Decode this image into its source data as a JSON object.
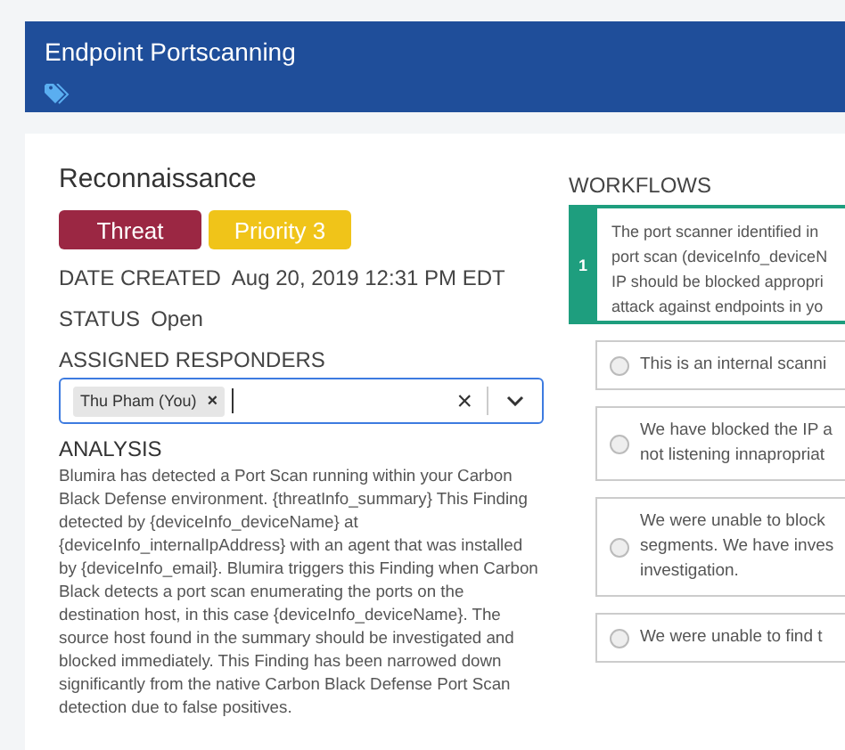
{
  "header": {
    "title": "Endpoint Portscanning"
  },
  "finding": {
    "name": "Reconnaissance",
    "badges": [
      {
        "label": "Threat",
        "color": "#9b2743"
      },
      {
        "label": "Priority 3",
        "color": "#f0c419"
      }
    ],
    "date_created": {
      "label": "DATE CREATED",
      "value": "Aug 20, 2019 12:31 PM EDT"
    },
    "status": {
      "label": "STATUS",
      "value": "Open"
    },
    "assigned_responders": {
      "label": "ASSIGNED RESPONDERS",
      "chips": [
        "Thu Pham (You)"
      ],
      "chip_remove": "×",
      "clear": "×"
    },
    "analysis": {
      "label": "ANALYSIS",
      "text": "Blumira has detected a Port Scan running within your Carbon Black Defense environment. {threatInfo_summary} This Finding detected by {deviceInfo_deviceName} at {deviceInfo_internalIpAddress} with an agent that was installed by {deviceInfo_email}. Blumira triggers this Finding when Carbon Black detects a port scan enumerating the ports on the destination host, in this case {deviceInfo_deviceName}. The source host found in the summary should be investigated and blocked immediately. This Finding has been narrowed down significantly from the native Carbon Black Defense Port Scan detection due to false positives."
    }
  },
  "workflows": {
    "label": "WORKFLOWS",
    "step": {
      "number": "1",
      "lines": [
        "The port scanner identified in",
        "port scan (deviceInfo_deviceN",
        "IP should be blocked appropri",
        "attack against endpoints in yo"
      ]
    },
    "options": [
      {
        "lines": [
          "This is an internal scanni"
        ],
        "selected": false
      },
      {
        "lines": [
          "We have blocked the IP a",
          "not listening innapropriat"
        ],
        "selected": false
      },
      {
        "lines": [
          "We were unable to block",
          "segments. We have inves",
          "investigation."
        ],
        "selected": false
      },
      {
        "lines": [
          "We were unable to find t"
        ],
        "selected": false
      }
    ]
  }
}
